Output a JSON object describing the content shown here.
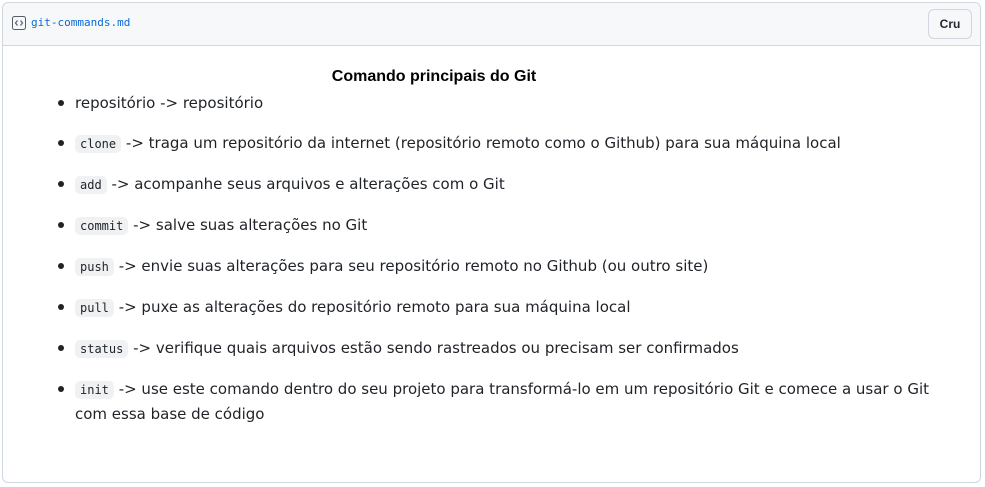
{
  "header": {
    "file_name": "git-commands.md",
    "raw_label": "Cru"
  },
  "doc": {
    "title": "Comando principais do Git",
    "items": [
      {
        "command": "",
        "text": "repositório -> repositório"
      },
      {
        "command": "clone",
        "text": "-> traga um repositório da internet (repositório remoto como o Github) para sua máquina local"
      },
      {
        "command": "add",
        "text": "-> acompanhe seus arquivos e alterações com o Git"
      },
      {
        "command": "commit",
        "text": "-> salve suas alterações no Git"
      },
      {
        "command": "push",
        "text": "-> envie suas alterações para seu repositório remoto no Github (ou outro site)"
      },
      {
        "command": "pull",
        "text": "-> puxe as alterações do repositório remoto para sua máquina local"
      },
      {
        "command": "status",
        "text": "-> verifique quais arquivos estão sendo rastreados ou precisam ser confirmados"
      },
      {
        "command": "init",
        "text": "-> use este comando dentro do seu projeto para transformá-lo em um repositório Git e comece a usar o Git com essa base de código"
      }
    ]
  }
}
